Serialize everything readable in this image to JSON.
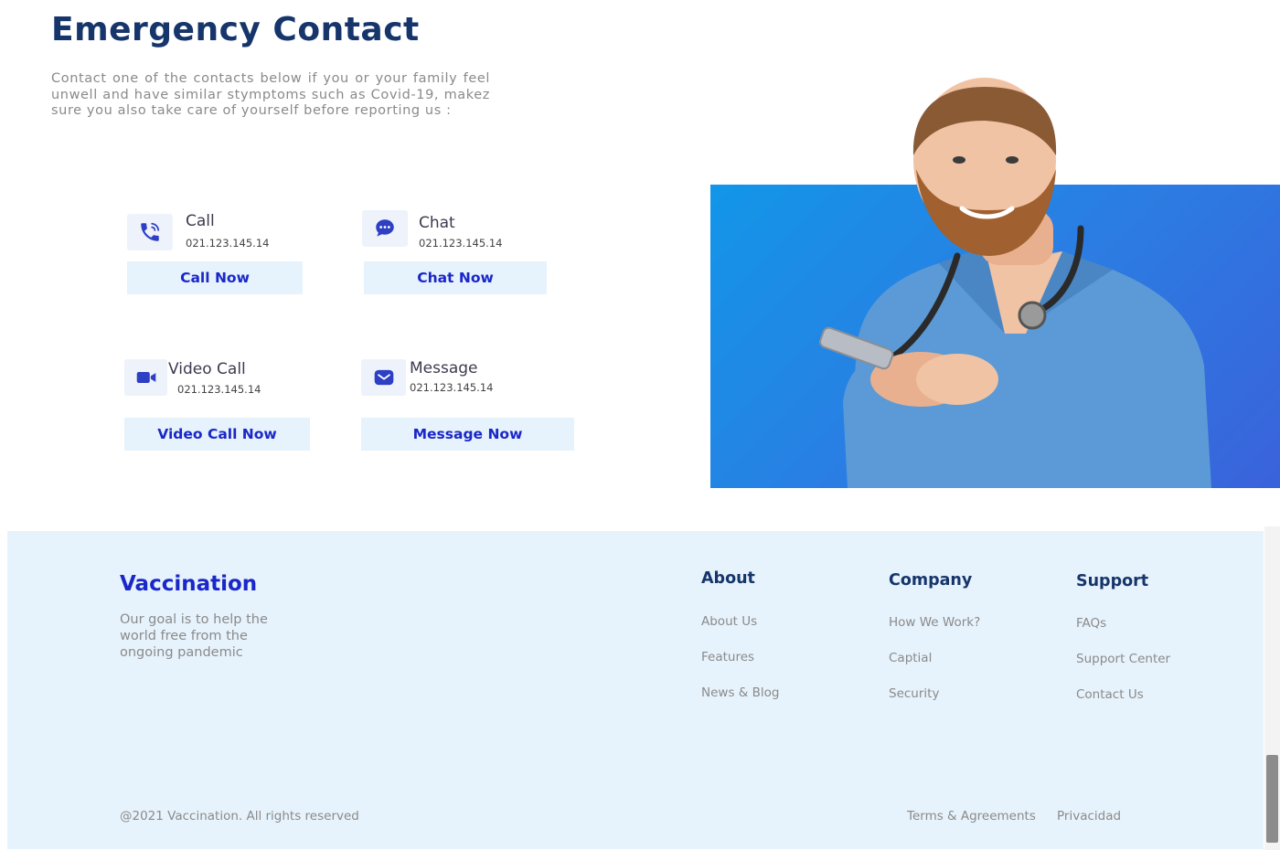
{
  "header": {
    "title": "Emergency Contact",
    "intro": "Contact one of the contacts below if you or your family feel unwell and have similar stymptoms such as Covid-19, makez sure you also take care of yourself before reporting us :"
  },
  "contacts": [
    {
      "label": "Call",
      "number": "021.123.145.14",
      "button": "Call Now",
      "icon": "phone-icon"
    },
    {
      "label": "Chat",
      "number": "021.123.145.14",
      "button": "Chat Now",
      "icon": "chat-bubble-icon"
    },
    {
      "label": "Video Call",
      "number": "021.123.145.14",
      "button": "Video Call Now",
      "icon": "video-camera-icon"
    },
    {
      "label": "Message",
      "number": "021.123.145.14",
      "button": "Message Now",
      "icon": "envelope-icon"
    }
  ],
  "hero": {
    "image": "doctor-with-phone-photo"
  },
  "footer": {
    "brand": "Vaccination",
    "tagline": "Our goal is to help the world free from the ongoing pandemic",
    "columns": [
      {
        "title": "About",
        "links": [
          "About Us",
          "Features",
          "News & Blog"
        ]
      },
      {
        "title": "Company",
        "links": [
          "How We Work?",
          "Captial",
          "Security"
        ]
      },
      {
        "title": "Support",
        "links": [
          "FAQs",
          "Support Center",
          "Contact Us"
        ]
      }
    ],
    "copyright": "@2021 Vaccination. All rights reserved",
    "legal": [
      "Terms & Agreements",
      "Privacidad"
    ]
  },
  "colors": {
    "title": "#16356b",
    "accent": "#1a27c9",
    "button_bg": "#e6f2fc",
    "footer_bg": "#e7f3fc",
    "hero_gradient_start": "#1296e8",
    "hero_gradient_end": "#3a62da"
  }
}
